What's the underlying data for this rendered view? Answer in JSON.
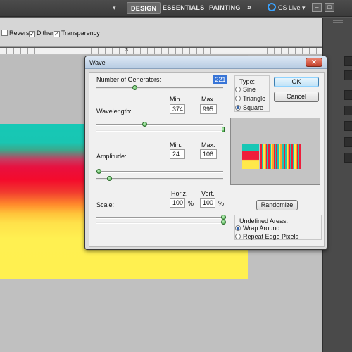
{
  "appbar": {
    "caret": "▾",
    "workspaces": [
      "DESIGN",
      "ESSENTIALS",
      "PAINTING"
    ],
    "more": "»",
    "cs_live": "CS Live ▾",
    "window_min": "–",
    "window_max": "□"
  },
  "options": {
    "reverse": "Reverse",
    "dither": "Dither",
    "transparency": "Transparency",
    "checked": "✓"
  },
  "ruler": {
    "tick_3": "3"
  },
  "dialog": {
    "title": "Wave",
    "close": "✕",
    "generators": {
      "label": "Number of Generators:",
      "value": "221",
      "slider": 0.3
    },
    "type": {
      "label": "Type:",
      "options": [
        "Sine",
        "Triangle",
        "Square"
      ],
      "selected": "Square"
    },
    "ok": "OK",
    "cancel": "Cancel",
    "wavelength": {
      "label": "Wavelength:",
      "min_label": "Min.",
      "max_label": "Max.",
      "min": "374",
      "max": "995",
      "min_slider": 0.38,
      "max_slider": 1.0
    },
    "amplitude": {
      "label": "Amplitude:",
      "min_label": "Min.",
      "max_label": "Max.",
      "min": "24",
      "max": "106",
      "min_slider": 0.02,
      "max_slider": 0.1
    },
    "scale": {
      "label": "Scale:",
      "horiz_label": "Horiz.",
      "vert_label": "Vert.",
      "horiz": "100",
      "vert": "100",
      "unit": "%",
      "horiz_slider": 1.0,
      "vert_slider": 1.0
    },
    "randomize": "Randomize",
    "undefined_areas": {
      "label": "Undefined Areas:",
      "options": [
        "Wrap Around",
        "Repeat Edge Pixels"
      ],
      "selected": "Wrap Around"
    }
  }
}
